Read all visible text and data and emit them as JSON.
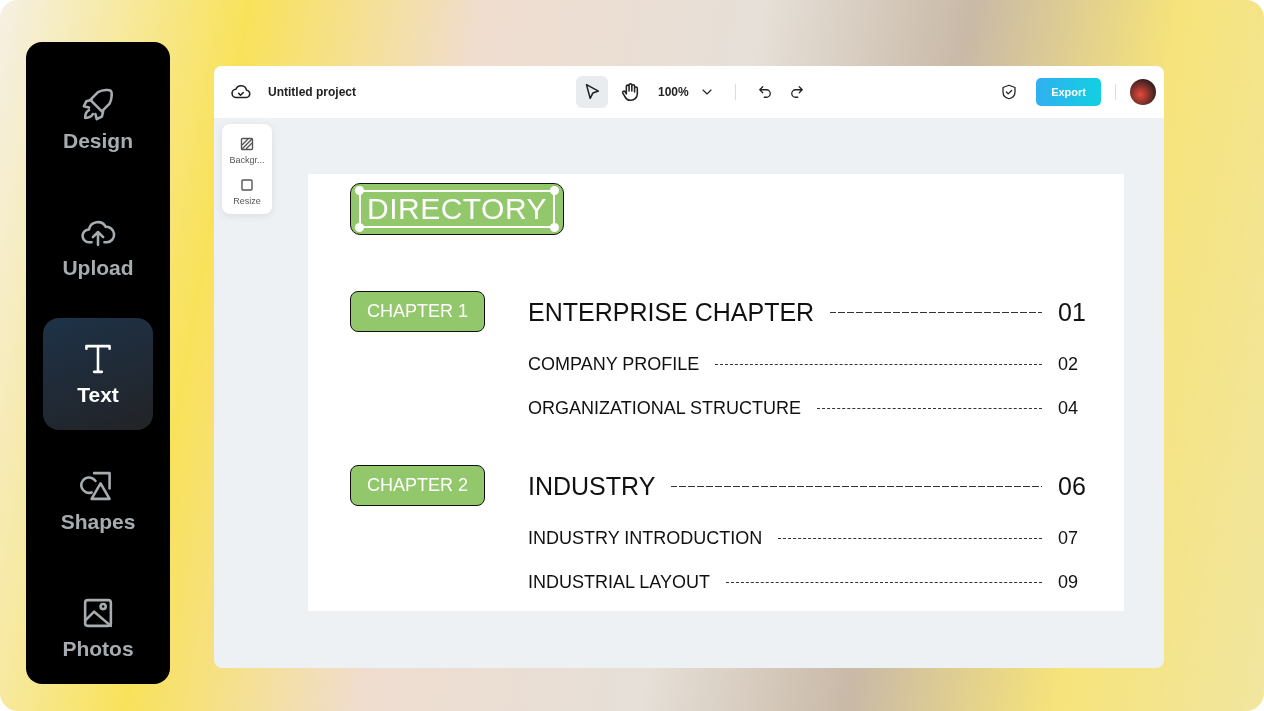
{
  "sidebar": {
    "items": [
      {
        "label": "Design",
        "kind": "design",
        "selected": false
      },
      {
        "label": "Upload",
        "kind": "upload",
        "selected": false
      },
      {
        "label": "Text",
        "kind": "text",
        "selected": true
      },
      {
        "label": "Shapes",
        "kind": "shapes",
        "selected": false
      },
      {
        "label": "Photos",
        "kind": "photos",
        "selected": false
      }
    ]
  },
  "toolbar": {
    "project_title": "Untitled project",
    "tools": [
      {
        "kind": "pointer",
        "selected": true
      },
      {
        "kind": "hand",
        "selected": false
      }
    ],
    "zoom": "100%",
    "export_button": "Export"
  },
  "side_panel": {
    "items": [
      {
        "label": "Backgr...",
        "kind": "background"
      },
      {
        "label": "Resize",
        "kind": "resize"
      }
    ]
  },
  "page": {
    "title": "DIRECTORY",
    "chapters": [
      {
        "label": "CHAPTER 1",
        "entries": [
          {
            "kind": "main",
            "title": "ENTERPRISE CHAPTER",
            "page": "01"
          },
          {
            "kind": "sub",
            "title": "COMPANY PROFILE",
            "page": "02"
          },
          {
            "kind": "sub",
            "title": "ORGANIZATIONAL STRUCTURE",
            "page": "04"
          }
        ]
      },
      {
        "label": "CHAPTER 2",
        "entries": [
          {
            "kind": "main",
            "title": "INDUSTRY",
            "page": "06"
          },
          {
            "kind": "sub",
            "title": "INDUSTRY INTRODUCTION",
            "page": "07"
          },
          {
            "kind": "sub",
            "title": "INDUSTRIAL LAYOUT",
            "page": "09"
          }
        ]
      }
    ]
  }
}
